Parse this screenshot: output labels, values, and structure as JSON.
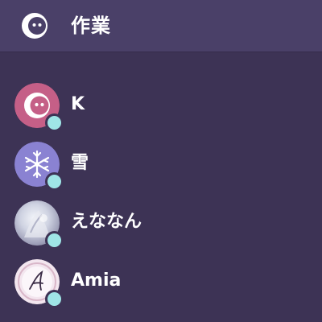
{
  "colors": {
    "background": "#3d3355",
    "header_background": "#4a4068",
    "text": "#ffffff",
    "status_online": "#9fe5e6",
    "accent_pink": "#c55f87",
    "accent_purple": "#8a82d2"
  },
  "header": {
    "title": "作業",
    "icon": "crescent-moon-face-icon"
  },
  "members": [
    {
      "name": "K",
      "avatar": "crescent-moon-face-icon",
      "status": "online"
    },
    {
      "name": "雪",
      "avatar": "snowflake-icon",
      "status": "online"
    },
    {
      "name": "えななん",
      "avatar": "photo-avatar",
      "status": "online"
    },
    {
      "name": "Amia",
      "avatar": "script-a-monogram-icon",
      "status": "online"
    }
  ]
}
